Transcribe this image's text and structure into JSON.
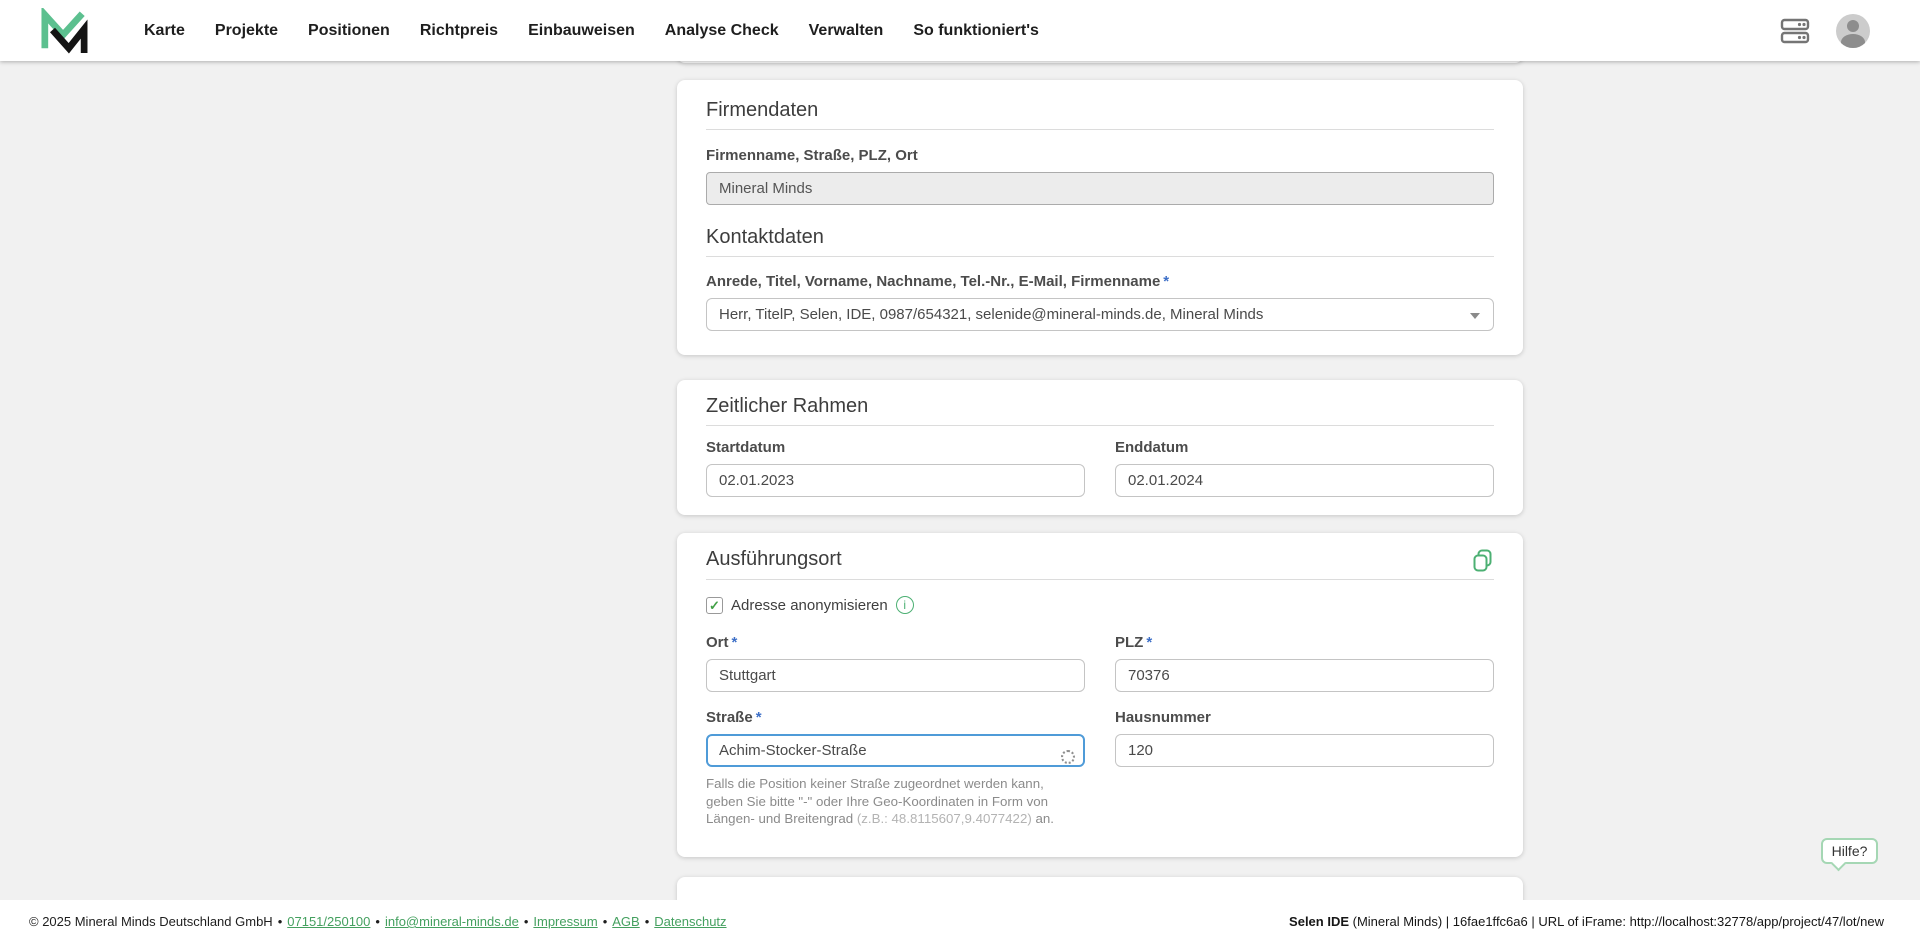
{
  "colors": {
    "accent_green": "#4cb073",
    "logo_green": "#5cc08f",
    "asterisk_blue": "#3d6fc7",
    "focus_blue": "#4f9bd8",
    "page_background": "#f1f1f1"
  },
  "header": {
    "nav": [
      "Karte",
      "Projekte",
      "Positionen",
      "Richtpreis",
      "Einbauweisen",
      "Analyse Check",
      "Verwalten",
      "So funktioniert's"
    ]
  },
  "misc": {
    "required_mark": "*"
  },
  "icons": {
    "check_glyph": "✓",
    "info_glyph": "i"
  },
  "firmendaten": {
    "title": "Firmendaten",
    "company_label": "Firmenname, Straße, PLZ, Ort",
    "company_value": "Mineral Minds",
    "kontakt_title": "Kontaktdaten",
    "kontakt_label": "Anrede, Titel, Vorname, Nachname, Tel.-Nr., E-Mail, Firmenname",
    "kontakt_value": "Herr, TitelP, Selen, IDE, 0987/654321, selenide@mineral-minds.de, Mineral Minds"
  },
  "zeitraum": {
    "title": "Zeitlicher Rahmen",
    "start_label": "Startdatum",
    "start_value": "02.01.2023",
    "end_label": "Enddatum",
    "end_value": "02.01.2024"
  },
  "ausfuehrungsort": {
    "title": "Ausführungsort",
    "anonym_label": "Adresse anonymisieren",
    "anonym_checked": true,
    "ort_label": "Ort",
    "ort_value": "Stuttgart",
    "plz_label": "PLZ",
    "plz_value": "70376",
    "strasse_label": "Straße",
    "strasse_value": "Achim-Stocker-Straße",
    "hausnummer_label": "Hausnummer",
    "hausnummer_value": "120",
    "helper_text": "Falls die Position keiner Straße zugeordnet werden kann, geben Sie bitte \"-\" oder Ihre Geo-Koordinaten in Form von Längen- und Breitengrad ",
    "helper_example": "(z.B.: 48.8115607,9.4077422)",
    "helper_suffix": " an."
  },
  "help": {
    "label": "Hilfe?"
  },
  "footer": {
    "copyright": "© 2025 Mineral Minds Deutschland GmbH",
    "separator": "•",
    "links": [
      "07151/250100",
      "info@mineral-minds.de",
      "Impressum",
      "AGB",
      "Datenschutz"
    ],
    "ide_bold": "Selen IDE",
    "ide_rest": " (Mineral Minds) | 16fae1ffc6a6 | URL of iFrame: http://localhost:32778/app/project/47/lot/new"
  }
}
